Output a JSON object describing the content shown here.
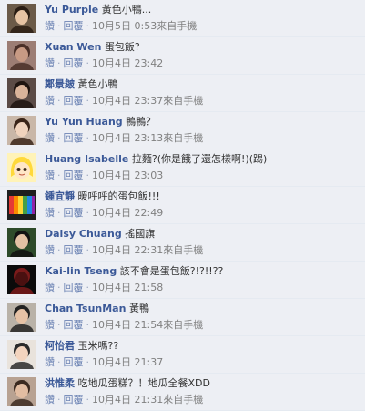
{
  "actions": {
    "like": "讚",
    "reply": "回覆",
    "separator": "·"
  },
  "comments": [
    {
      "author": "Yu Purple",
      "text": "黃色小鴨...",
      "timestamp": "10月5日 0:53",
      "source": "來自手機",
      "avatar": "avatar-photo"
    },
    {
      "author": "Xuan Wen",
      "text": "蛋包飯?",
      "timestamp": "10月4日 23:42",
      "source": "",
      "avatar": "avatar-photo"
    },
    {
      "author": "鄭景皴",
      "text": "黃色小鴨",
      "timestamp": "10月4日 23:37",
      "source": "來自手機",
      "avatar": "avatar-photo"
    },
    {
      "author": "Yu Yun Huang",
      "text": "鴨鴨？",
      "timestamp": "10月4日 23:13",
      "source": "來自手機",
      "avatar": "avatar-photo"
    },
    {
      "author": "Huang Isabelle",
      "text": "拉麵?(你是餓了還怎樣啊!)(踢)",
      "timestamp": "10月4日 23:03",
      "source": "",
      "avatar": "avatar-cartoon"
    },
    {
      "author": "鍾宜靜",
      "text": "暖呼呼的蛋包飯!!!",
      "timestamp": "10月4日 22:49",
      "source": "",
      "avatar": "avatar-photo"
    },
    {
      "author": "Daisy Chuang",
      "text": "搖國旗",
      "timestamp": "10月4日 22:31",
      "source": "來自手機",
      "avatar": "avatar-photo"
    },
    {
      "author": "Kai-lin Tseng",
      "text": "該不會是蛋包飯?!?!!??",
      "timestamp": "10月4日 21:58",
      "source": "",
      "avatar": "avatar-photo"
    },
    {
      "author": "Chan TsunMan",
      "text": "黃鴨",
      "timestamp": "10月4日 21:54",
      "source": "來自手機",
      "avatar": "avatar-photo"
    },
    {
      "author": "柯怡君",
      "text": "玉米嗎??",
      "timestamp": "10月4日 21:37",
      "source": "",
      "avatar": "avatar-photo"
    },
    {
      "author": "洪惟柔",
      "text": "吃地瓜蛋糕？！地瓜全餐XDD",
      "timestamp": "10月4日 21:31",
      "source": "來自手機",
      "avatar": "avatar-photo"
    }
  ]
}
